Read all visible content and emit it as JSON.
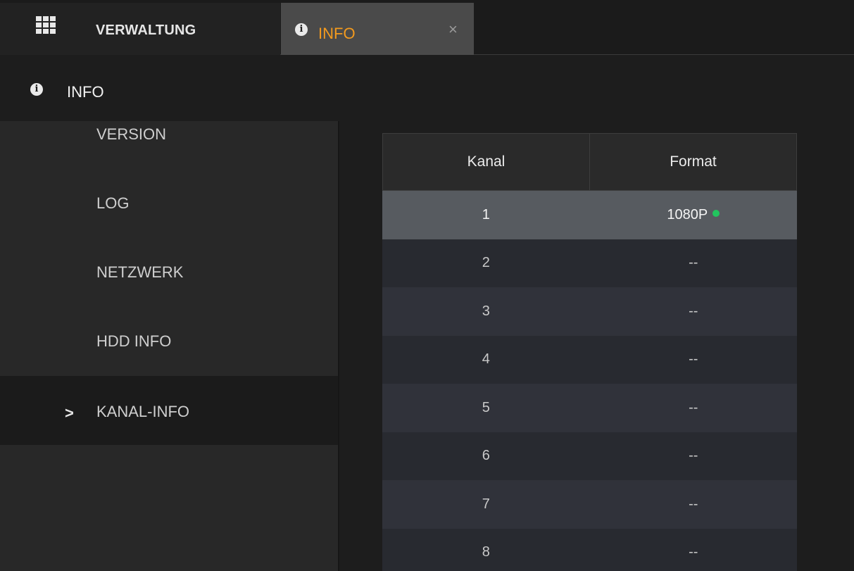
{
  "tabs": {
    "home_label": "VERWALTUNG",
    "active_label": "INFO",
    "close_symbol": "×",
    "active_color": "#f39a1e"
  },
  "icons": {
    "apps": "grid-icon",
    "info": "info-icon",
    "close": "close-icon",
    "chevron": "chevron-right-icon"
  },
  "page": {
    "title": "INFO",
    "info_glyph": "i"
  },
  "sidebar": {
    "items": [
      {
        "label": "VERSION",
        "active": false
      },
      {
        "label": "LOG",
        "active": false
      },
      {
        "label": "NETZWERK",
        "active": false
      },
      {
        "label": "HDD INFO",
        "active": false
      },
      {
        "label": "KANAL-INFO",
        "active": true
      }
    ],
    "chevron": ">"
  },
  "table": {
    "headers": [
      "Kanal",
      "Format"
    ],
    "rows": [
      {
        "channel": "1",
        "format": "1080P",
        "status_color": "#22c55e",
        "selected": true
      },
      {
        "channel": "2",
        "format": "--"
      },
      {
        "channel": "3",
        "format": "--"
      },
      {
        "channel": "4",
        "format": "--"
      },
      {
        "channel": "5",
        "format": "--"
      },
      {
        "channel": "6",
        "format": "--"
      },
      {
        "channel": "7",
        "format": "--"
      },
      {
        "channel": "8",
        "format": "--"
      }
    ]
  }
}
